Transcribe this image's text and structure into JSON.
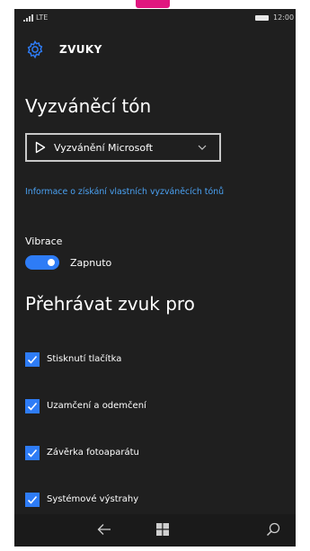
{
  "status_bar": {
    "network": "LTE",
    "time": "12:00"
  },
  "header": {
    "title": "ZVUKY"
  },
  "ringtone": {
    "heading": "Vyzváněcí tón",
    "selected": "Vyzvánění Microsoft",
    "link_text": "Informace o získání vlastních vyzváněcích tónů"
  },
  "vibration": {
    "label": "Vibrace",
    "state_label": "Zapnuto",
    "on": true
  },
  "play_sounds": {
    "heading": "Přehrávat zvuk pro",
    "items": [
      {
        "label": "Stisknutí tlačítka",
        "checked": true
      },
      {
        "label": "Uzamčení a odemčení",
        "checked": true
      },
      {
        "label": "Závěrka fotoaparátu",
        "checked": true
      },
      {
        "label": "Systémové výstrahy",
        "checked": true
      }
    ]
  },
  "colors": {
    "accent": "#2e7cf6",
    "link": "#4aa1f2",
    "background": "#1f1f1f",
    "top_marker": "#e0167f"
  },
  "icons": {
    "settings": "gear-icon",
    "play": "play-icon",
    "dropdown": "chevron-down-icon",
    "back": "back-arrow-icon",
    "start": "windows-start-icon",
    "search": "search-icon"
  }
}
